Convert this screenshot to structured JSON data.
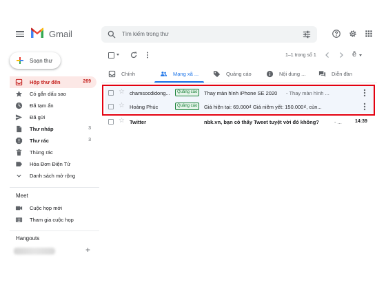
{
  "header": {
    "app_title": "Gmail",
    "search_placeholder": "Tìm kiếm trong thư"
  },
  "compose": {
    "label": "Soạn thư"
  },
  "sidebar": {
    "items": [
      {
        "label": "Hộp thư đến",
        "count": "269",
        "icon": "inbox-icon",
        "active": true
      },
      {
        "label": "Có gắn dấu sao",
        "count": "",
        "icon": "star-icon"
      },
      {
        "label": "Đã tạm ẩn",
        "count": "",
        "icon": "clock-icon"
      },
      {
        "label": "Đã gửi",
        "count": "",
        "icon": "send-icon"
      },
      {
        "label": "Thư nháp",
        "count": "3",
        "icon": "draft-icon",
        "bold": true
      },
      {
        "label": "Thư rác",
        "count": "3",
        "icon": "spam-icon",
        "bold": true
      },
      {
        "label": "Thùng rác",
        "count": "",
        "icon": "trash-icon"
      },
      {
        "label": "Hóa Đơn Điện Tử",
        "count": "",
        "icon": "label-icon"
      },
      {
        "label": "Danh sách mở rộng",
        "count": "",
        "icon": "chevron-down-icon"
      }
    ],
    "meet": {
      "title": "Meet",
      "items": [
        {
          "label": "Cuộc họp mới",
          "icon": "video-icon"
        },
        {
          "label": "Tham gia cuộc họp",
          "icon": "keyboard-icon"
        }
      ]
    },
    "hangouts": {
      "title": "Hangouts",
      "add": "+"
    }
  },
  "toolbar": {
    "pager": "1–1 trong số 1",
    "input_tools": "ê"
  },
  "tabs": [
    {
      "label": "Chính",
      "icon": "inbox-tab-icon"
    },
    {
      "label": "Mạng xã ...",
      "icon": "people-icon",
      "active": true
    },
    {
      "label": "Quảng cáo",
      "icon": "tag-icon"
    },
    {
      "label": "Nội dung ...",
      "icon": "info-icon"
    },
    {
      "label": "Diễn đàn",
      "icon": "forum-icon"
    }
  ],
  "emails": [
    {
      "sender": "chamsocdidong...",
      "badge": "Quảng cáo",
      "subject": "Thay màn hình iPhone SE 2020",
      "snippet": " - Thay màn hình ...",
      "read": true
    },
    {
      "sender": "Hoàng Phúc",
      "badge": "Quảng cáo",
      "subject": "Giá hiện tại: 69.000₫ Giá niêm yết: 150.000₫, cùn...",
      "snippet": "",
      "read": true
    },
    {
      "sender": "Twitter",
      "subject": "nbk.vn, bạn có thấy Tweet tuyệt vời đó không?",
      "snippet": " - ...",
      "time": "14:39",
      "read": false
    }
  ],
  "colors": {
    "accent": "#1a73e8",
    "inbox_active_bg": "#fce8e6",
    "inbox_active_text": "#c5221f",
    "highlight_border": "#e3000f",
    "badge_green": "#188038"
  }
}
